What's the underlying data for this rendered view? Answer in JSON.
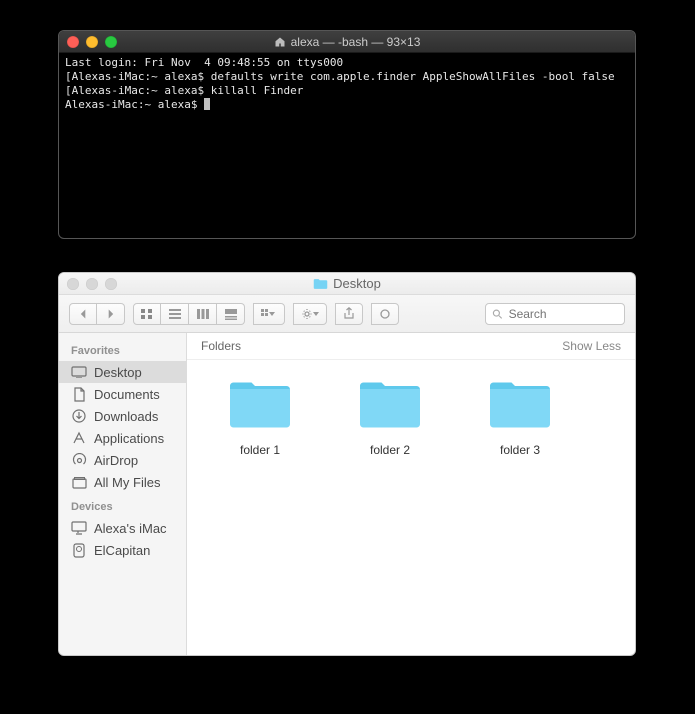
{
  "terminal": {
    "title": "alexa — -bash — 93×13",
    "lines": [
      "Last login: Fri Nov  4 09:48:55 on ttys000",
      "[Alexas-iMac:~ alexa$ defaults write com.apple.finder AppleShowAllFiles -bool false              ]",
      "[Alexas-iMac:~ alexa$ killall Finder                                                              ]",
      "Alexas-iMac:~ alexa$ "
    ]
  },
  "finder": {
    "title": "Desktop",
    "search_placeholder": "Search",
    "sidebar": {
      "section1": "Favorites",
      "items1": [
        "Desktop",
        "Documents",
        "Downloads",
        "Applications",
        "AirDrop",
        "All My Files"
      ],
      "section2": "Devices",
      "items2": [
        "Alexa's iMac",
        "ElCapitan"
      ]
    },
    "section": {
      "title": "Folders",
      "toggle": "Show Less"
    },
    "folders": [
      "folder 1",
      "folder 2",
      "folder 3"
    ]
  }
}
